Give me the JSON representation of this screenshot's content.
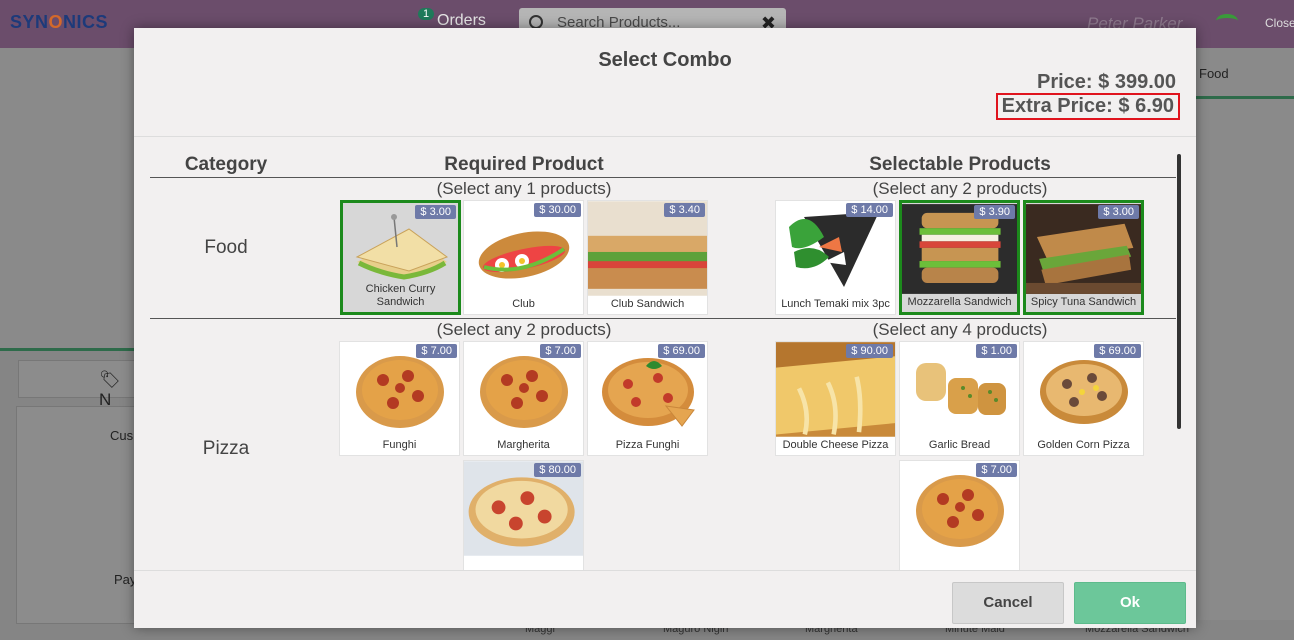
{
  "background": {
    "logo_prefix": "SYN",
    "logo_middle": "O",
    "logo_suffix": "NICS",
    "orders_badge": "1",
    "orders_label": "Orders",
    "search_placeholder": "Search Products...",
    "user_name": "Peter Parker",
    "close_label": "Close",
    "category_tab": "Food",
    "note_label": "N",
    "customer_label": "Cus",
    "payment_label": "Pay",
    "bottom_products": [
      "Maggi",
      "Maguro Nigiri",
      "Margherita",
      "Minute Maid",
      "Mozzarella Sandwich"
    ]
  },
  "modal": {
    "title": "Select Combo",
    "price": "Price: $ 399.00",
    "extra_price": "Extra Price: $ 6.90",
    "columns": {
      "category": "Category",
      "required": "Required Product",
      "selectable": "Selectable Products"
    },
    "categories": [
      {
        "name": "Food",
        "required_label": "(Select any 1 products)",
        "selectable_label": "(Select any 2 products)",
        "required_products": [
          {
            "name": "Chicken Curry Sandwich",
            "price": "$ 3.00",
            "selected": true
          },
          {
            "name": "Club",
            "price": "$ 30.00",
            "selected": false
          },
          {
            "name": "Club Sandwich",
            "price": "$ 3.40",
            "selected": false
          }
        ],
        "selectable_products": [
          {
            "name": "Lunch Temaki mix 3pc",
            "price": "$ 14.00",
            "selected": false
          },
          {
            "name": "Mozzarella Sandwich",
            "price": "$ 3.90",
            "selected": true
          },
          {
            "name": "Spicy Tuna Sandwich",
            "price": "$ 3.00",
            "selected": true
          }
        ]
      },
      {
        "name": "Pizza",
        "required_label": "(Select any 2 products)",
        "selectable_label": "(Select any 4 products)",
        "required_products": [
          {
            "name": "Funghi",
            "price": "$ 7.00",
            "selected": false
          },
          {
            "name": "Margherita",
            "price": "$ 7.00",
            "selected": false
          },
          {
            "name": "Pizza Funghi",
            "price": "$ 69.00",
            "selected": false
          },
          {
            "name": "",
            "price": "$ 80.00",
            "selected": false
          }
        ],
        "selectable_products": [
          {
            "name": "Double Cheese Pizza",
            "price": "$ 90.00",
            "selected": false
          },
          {
            "name": "Garlic Bread",
            "price": "$ 1.00",
            "selected": false
          },
          {
            "name": "Golden Corn Pizza",
            "price": "$ 69.00",
            "selected": false
          },
          {
            "name": "",
            "price": "$ 7.00",
            "selected": false
          }
        ]
      }
    ],
    "cancel_label": "Cancel",
    "ok_label": "Ok"
  }
}
